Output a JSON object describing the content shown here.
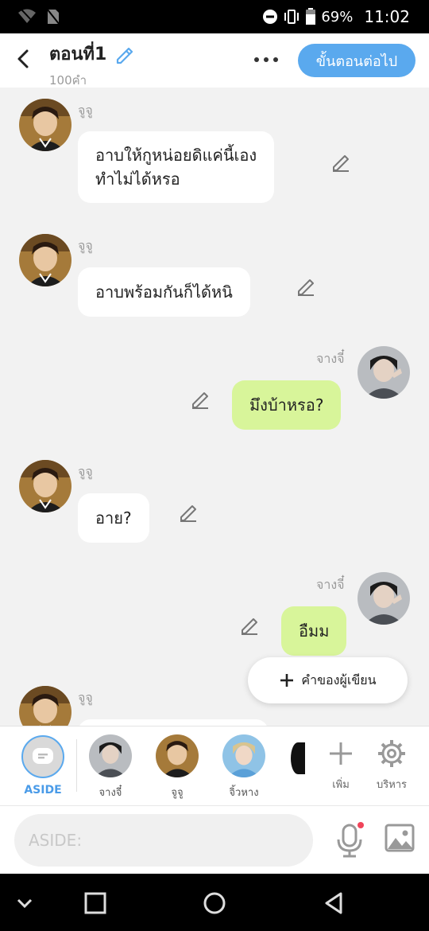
{
  "status": {
    "battery": "69%",
    "time": "11:02"
  },
  "header": {
    "title": "ตอนที่1",
    "subtitle": "100คำ",
    "next_label": "ขั้นตอนต่อไป"
  },
  "messages": [
    {
      "side": "in",
      "name": "จูจู",
      "lines": [
        "อาบให้กูหน่อยดิแค่นี้เอง",
        "ทำไม่ได้หรอ"
      ]
    },
    {
      "side": "in",
      "name": "จูจู",
      "lines": [
        "อาบพร้อมกันก็ได้หนิ"
      ]
    },
    {
      "side": "out",
      "name": "จางจี๋",
      "lines": [
        "มึงบ้าหรอ?"
      ]
    },
    {
      "side": "in",
      "name": "จูจู",
      "lines": [
        "อาย?"
      ]
    },
    {
      "side": "out",
      "name": "จางจี๋",
      "lines": [
        "อืมม"
      ]
    },
    {
      "side": "in",
      "name": "จูจู",
      "lines": []
    }
  ],
  "fab": {
    "label": "คำของผู้เขียน"
  },
  "characters": {
    "aside_label": "ASIDE",
    "items": [
      {
        "label": "จางจี๋"
      },
      {
        "label": "จูจู"
      },
      {
        "label": "จิ้วหาง"
      }
    ],
    "add_label": "เพิ่ม",
    "manage_label": "บริหาร"
  },
  "input": {
    "placeholder": "ASIDE:"
  },
  "colors": {
    "accent": "#5aa9ee",
    "outgoing_bubble": "#d8f59a",
    "incoming_bubble": "#ffffff",
    "mic_dot": "#f0455a"
  }
}
